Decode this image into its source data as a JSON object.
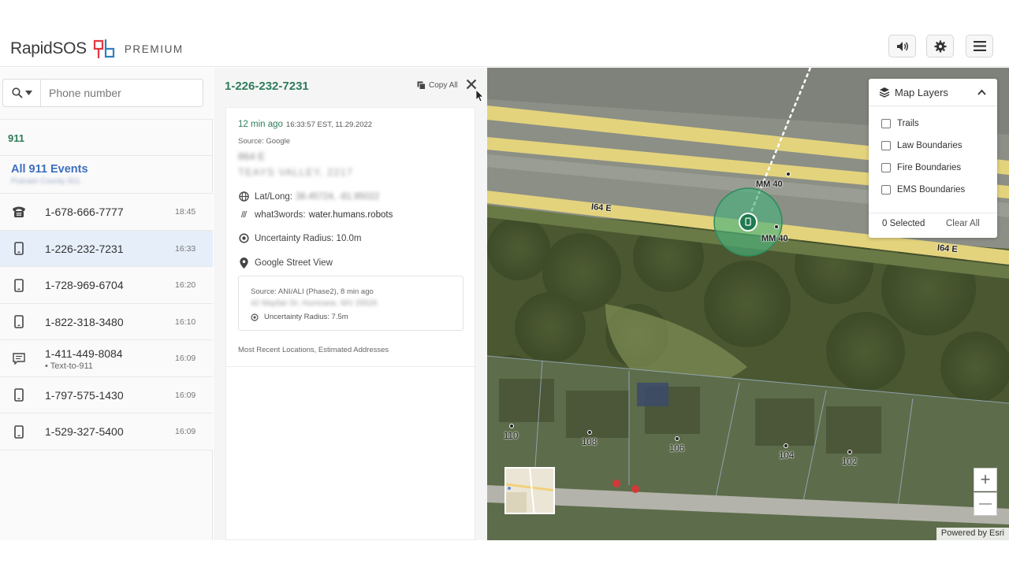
{
  "header": {
    "logo_text": "RapidSOS",
    "logo_tier": "PREMIUM",
    "buttons": [
      "volume-icon",
      "settings-icon",
      "menu-icon"
    ]
  },
  "sidebar": {
    "search_placeholder": "Phone number",
    "section_label": "911",
    "all_events_title": "All 911 Events",
    "all_events_subtitle": "Putnam County 911",
    "calls": [
      {
        "number": "1-678-666-7777",
        "time": "18:45",
        "icon": "landline-phone-icon",
        "sub": ""
      },
      {
        "number": "1-226-232-7231",
        "time": "16:33",
        "icon": "mobile-phone-icon",
        "sub": "",
        "active": true
      },
      {
        "number": "1-728-969-6704",
        "time": "16:20",
        "icon": "mobile-phone-icon",
        "sub": ""
      },
      {
        "number": "1-822-318-3480",
        "time": "16:10",
        "icon": "mobile-phone-icon",
        "sub": ""
      },
      {
        "number": "1-411-449-8084",
        "time": "16:09",
        "icon": "chat-message-icon",
        "sub": "• Text-to-911"
      },
      {
        "number": "1-797-575-1430",
        "time": "16:09",
        "icon": "mobile-phone-icon",
        "sub": ""
      },
      {
        "number": "1-529-327-5400",
        "time": "16:09",
        "icon": "mobile-phone-icon",
        "sub": ""
      }
    ]
  },
  "detail": {
    "phone": "1-226-232-7231",
    "copy_all": "Copy All",
    "ago": "12 min ago",
    "timestamp": "16:33:57 EST, 11.29.2022",
    "source": "Source: Google",
    "address_line1": "864 E",
    "address_line2": "TEAYS VALLEY, 2217",
    "latlong_label": "Lat/Long:",
    "latlong_value": "38.45724, -81.95022",
    "w3w_label": "what3words:",
    "w3w_value": "water.humans.robots",
    "uncertainty": "Uncertainty Radius: 10.0m",
    "street_view": "Google Street View",
    "secondary": {
      "source": "Source: ANI/ALI (Phase2), 8 min ago",
      "address": "42 Mayfair Dr, Hurricane, WV 25526",
      "uncertainty": "Uncertainty Radius: 7.5m"
    },
    "recent_label": "Most Recent Locations, Estimated Addresses"
  },
  "map": {
    "layers_title": "Map Layers",
    "layers": [
      "Trails",
      "Law Boundaries",
      "Fire Boundaries",
      "EMS Boundaries"
    ],
    "selected_count": "0 Selected",
    "clear_all": "Clear All",
    "road_labels": [
      "I64 E",
      "I64 E",
      "MM 40",
      "MM 40"
    ],
    "house_numbers": [
      "110",
      "108",
      "106",
      "104",
      "102"
    ],
    "attribution": "Powered by Esri",
    "zoom_in": "+",
    "zoom_out": "—"
  }
}
